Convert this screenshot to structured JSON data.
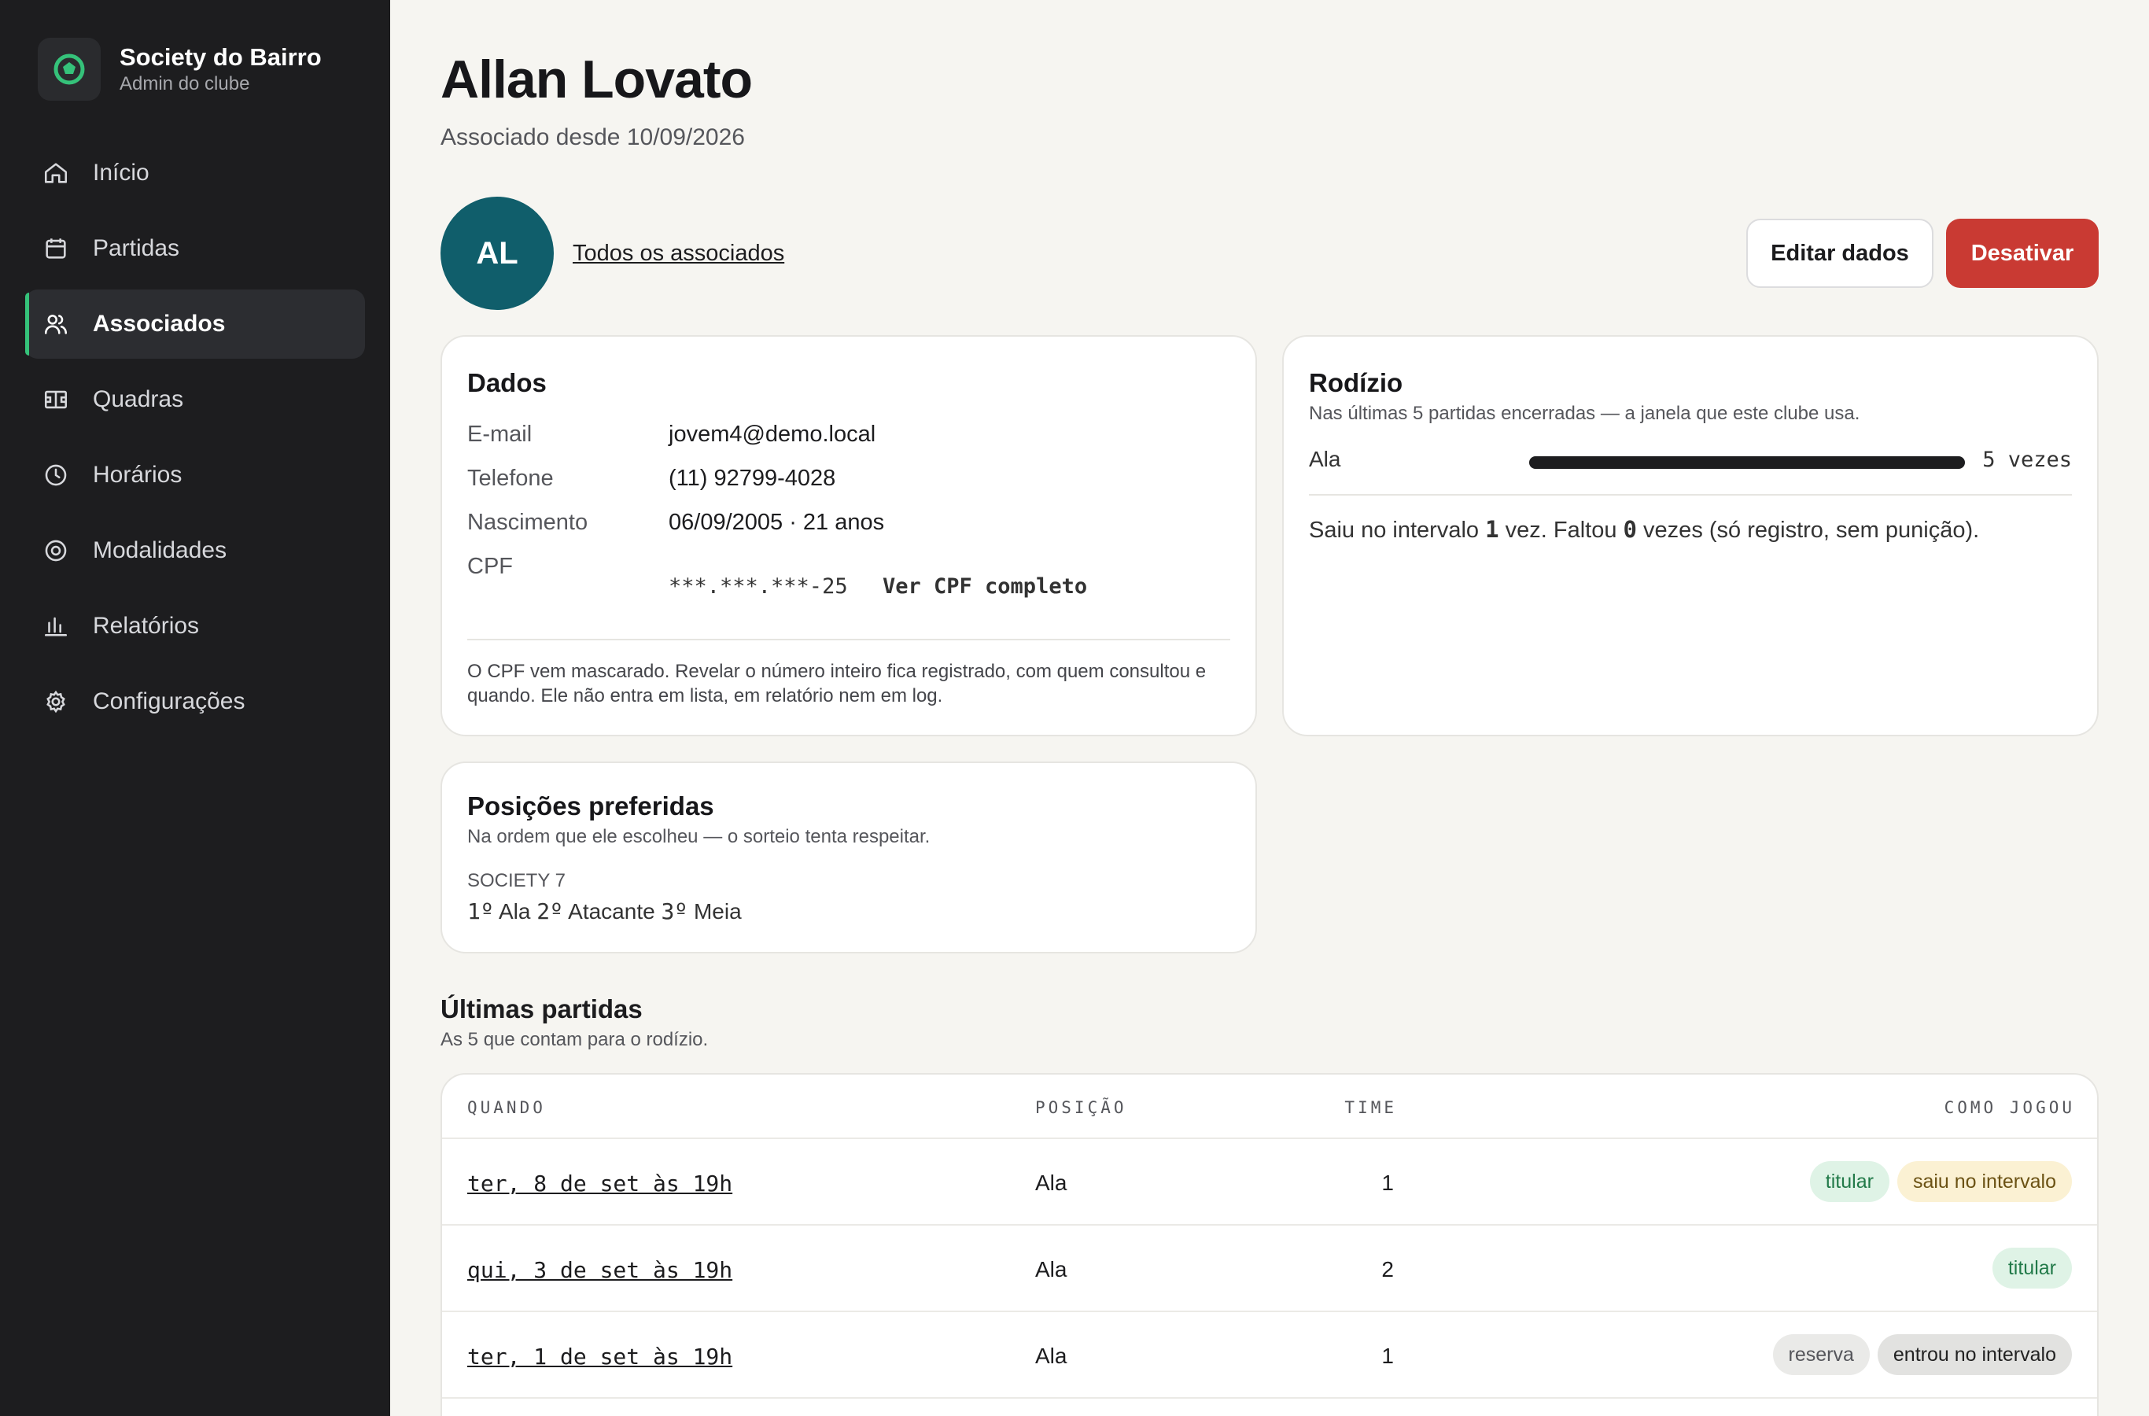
{
  "sidebar": {
    "brand_name": "Society do Bairro",
    "brand_sub": "Admin do clube",
    "items": [
      {
        "label": "Início",
        "icon": "home-icon"
      },
      {
        "label": "Partidas",
        "icon": "calendar-icon"
      },
      {
        "label": "Associados",
        "icon": "users-icon",
        "active": true
      },
      {
        "label": "Quadras",
        "icon": "court-icon"
      },
      {
        "label": "Horários",
        "icon": "clock-icon"
      },
      {
        "label": "Modalidades",
        "icon": "target-icon"
      },
      {
        "label": "Relatórios",
        "icon": "bar-chart-icon"
      },
      {
        "label": "Configurações",
        "icon": "gear-icon"
      }
    ]
  },
  "header": {
    "title": "Allan Lovato",
    "subtitle": "Associado desde 10/09/2026",
    "avatar_initials": "AL",
    "back_link": "Todos os associados",
    "edit_label": "Editar dados",
    "deactivate_label": "Desativar"
  },
  "dados": {
    "title": "Dados",
    "email_label": "E-mail",
    "email_value": "jovem4@demo.local",
    "phone_label": "Telefone",
    "phone_value": "(11) 92799-4028",
    "birth_label": "Nascimento",
    "birth_value": "06/09/2005 · 21 anos",
    "cpf_label": "CPF",
    "cpf_value": "***.***.***-25",
    "cpf_reveal": "Ver CPF completo",
    "note": "O CPF vem mascarado. Revelar o número inteiro fica registrado, com quem consultou e quando. Ele não entra em lista, em relatório nem em log."
  },
  "rodizio": {
    "title": "Rodízio",
    "subtitle": "Nas últimas 5 partidas encerradas — a janela que este clube usa.",
    "position": "Ala",
    "count_text": "5 vezes",
    "fill": 1.0,
    "summary_a": "Saiu no intervalo ",
    "summary_n1": "1",
    "summary_b": " vez. Faltou ",
    "summary_n2": "0",
    "summary_c": " vezes (só registro, sem punição)."
  },
  "posicoes": {
    "title": "Posições preferidas",
    "subtitle": "Na ordem que ele escolheu — o sorteio tenta respeitar.",
    "modality": "SOCIETY 7",
    "p1_rank": "1º",
    "p1": "Ala",
    "p2_rank": "2º",
    "p2": "Atacante",
    "p3_rank": "3º",
    "p3": "Meia"
  },
  "partidas": {
    "title": "Últimas partidas",
    "subtitle": "As 5 que contam para o rodízio.",
    "columns": {
      "quando": "QUANDO",
      "posicao": "POSIÇÃO",
      "time": "TIME",
      "como": "COMO JOGOU"
    },
    "rows": [
      {
        "quando": "ter, 8 de set às 19h",
        "posicao": "Ala",
        "time": "1",
        "tag1": "titular",
        "tag2": "saiu no intervalo"
      },
      {
        "quando": "qui, 3 de set às 19h",
        "posicao": "Ala",
        "time": "2",
        "tag1": "titular"
      },
      {
        "quando": "ter, 1 de set às 19h",
        "posicao": "Ala",
        "time": "1",
        "tag1": "reserva",
        "tag2": "entrou no intervalo"
      }
    ]
  }
}
